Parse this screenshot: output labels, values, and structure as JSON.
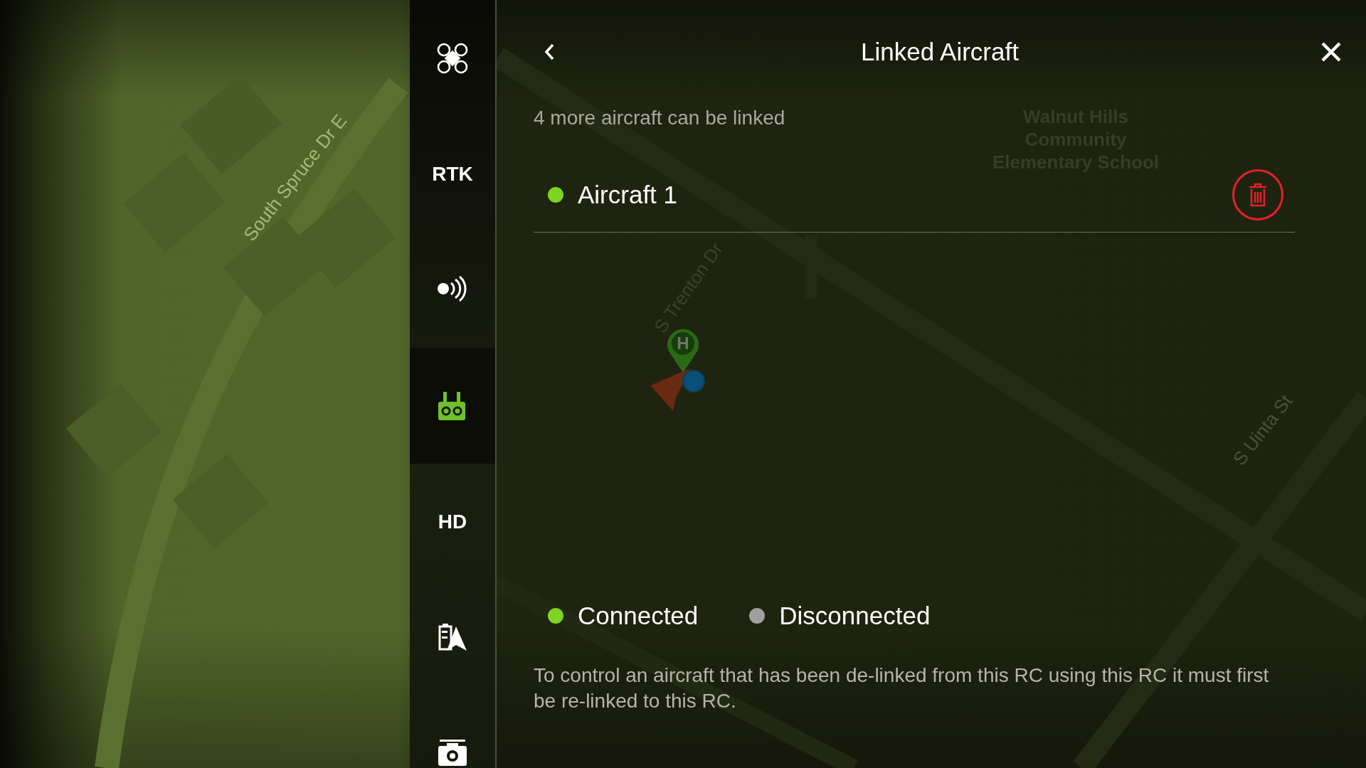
{
  "map": {
    "labels": [
      {
        "text": "South Spruce Dr E",
        "kind": "street"
      },
      {
        "text": "S Trenton Dr",
        "kind": "street"
      },
      {
        "text": "S Uinta St",
        "kind": "street"
      },
      {
        "text": "Walnut Hills Community Elementary School",
        "kind": "place"
      }
    ],
    "home_marker": {
      "label": "H"
    }
  },
  "sidebar": {
    "items": [
      {
        "kind": "drone",
        "selected": false
      },
      {
        "kind": "text",
        "label": "RTK",
        "selected": false
      },
      {
        "kind": "signal",
        "selected": false
      },
      {
        "kind": "controller",
        "selected": true
      },
      {
        "kind": "text",
        "label": "HD",
        "selected": false
      },
      {
        "kind": "battery",
        "selected": false
      },
      {
        "kind": "camera",
        "selected": false
      }
    ]
  },
  "panel": {
    "title": "Linked Aircraft",
    "subtitle": "4 more aircraft can be linked",
    "aircraft": [
      {
        "name": "Aircraft 1",
        "connected": true
      }
    ],
    "legend": [
      {
        "label": "Connected",
        "color": "#7ed321"
      },
      {
        "label": "Disconnected",
        "color": "#a0a0a0"
      }
    ],
    "note": "To control an aircraft that has been de-linked from this RC using this RC it must first be re-linked to this RC."
  }
}
